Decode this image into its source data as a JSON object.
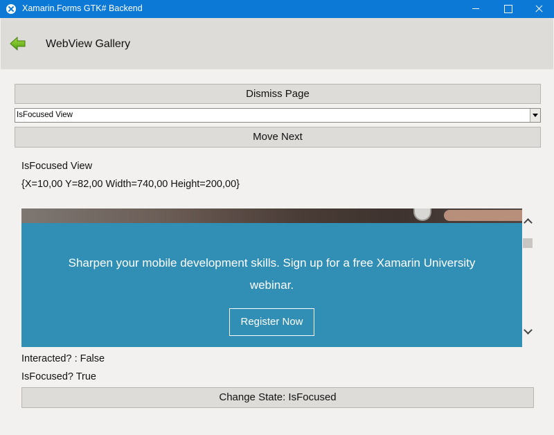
{
  "window": {
    "title": "Xamarin.Forms GTK# Backend",
    "titlebar_color": "#0c79d7",
    "controls": [
      "minimize-icon",
      "maximize-icon",
      "close-icon"
    ]
  },
  "navbar": {
    "title": "WebView Gallery",
    "back_icon": "green-back-arrow-icon"
  },
  "main": {
    "dismiss_label": "Dismiss Page",
    "picker_value": "IsFocused View",
    "move_next_label": "Move Next",
    "view_title": "IsFocused View",
    "bounds_text": "{X=10,00 Y=82,00 Width=740,00 Height=200,00}",
    "webview": {
      "banner_text": "Sharpen your mobile development skills. Sign up for a free Xamarin University webinar.",
      "register_label": "Register Now",
      "banner_color": "#318fb5"
    },
    "interacted_text": "Interacted? : False",
    "isfocused_text": "IsFocused?  True",
    "change_state_label": "Change State: IsFocused"
  }
}
